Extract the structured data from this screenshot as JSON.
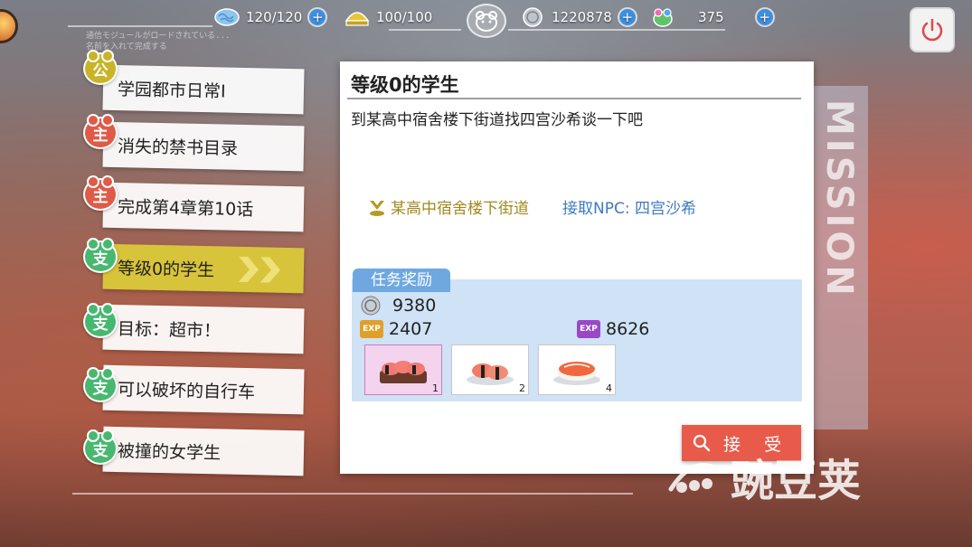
{
  "topbar": {
    "stamina": {
      "icon": "brain-stamina-icon",
      "value": "120/120"
    },
    "energy": {
      "icon": "gold-helmet-icon",
      "value": "100/100"
    },
    "coins": {
      "icon": "silver-coin-icon",
      "value": "1220878"
    },
    "gems": {
      "icon": "frog-gem-icon",
      "value": "375"
    }
  },
  "quests": [
    {
      "tag": "公",
      "type": "public",
      "label": "学园都市日常Ⅰ"
    },
    {
      "tag": "主",
      "type": "main",
      "label": "消失的禁书目录"
    },
    {
      "tag": "主",
      "type": "main",
      "label": "完成第4章第10话"
    },
    {
      "tag": "支",
      "type": "side",
      "label": "等级0的学生",
      "active": true
    },
    {
      "tag": "支",
      "type": "side",
      "label": "目标：超市！"
    },
    {
      "tag": "支",
      "type": "side",
      "label": "可以破坏的自行车"
    },
    {
      "tag": "支",
      "type": "side",
      "label": "被撞的女学生"
    }
  ],
  "detail": {
    "title": "等级0的学生",
    "description": "到某高中宿舍楼下街道找四宫沙希谈一下吧",
    "location": "某高中宿舍楼下街道",
    "npc": "接取NPC: 四宫沙希"
  },
  "reward": {
    "tab_label": "任务奖励",
    "coins": "9380",
    "exp": "2407",
    "partner_exp": "8626",
    "exp_badge": "EXP",
    "items": [
      {
        "icon": "sushi-platter-icon",
        "count": "1"
      },
      {
        "icon": "sushi-pair-icon",
        "count": "2"
      },
      {
        "icon": "salmon-sushi-icon",
        "count": "4"
      }
    ]
  },
  "accept_label": "接 受",
  "side_text": "MISSION",
  "watermark": "豌豆荚",
  "colors": {
    "accent_yellow": "#d8c43a",
    "main_red": "#e05a48",
    "side_green": "#48b870",
    "accept_red": "#e85a4a",
    "npc_blue": "#3f79c4"
  }
}
